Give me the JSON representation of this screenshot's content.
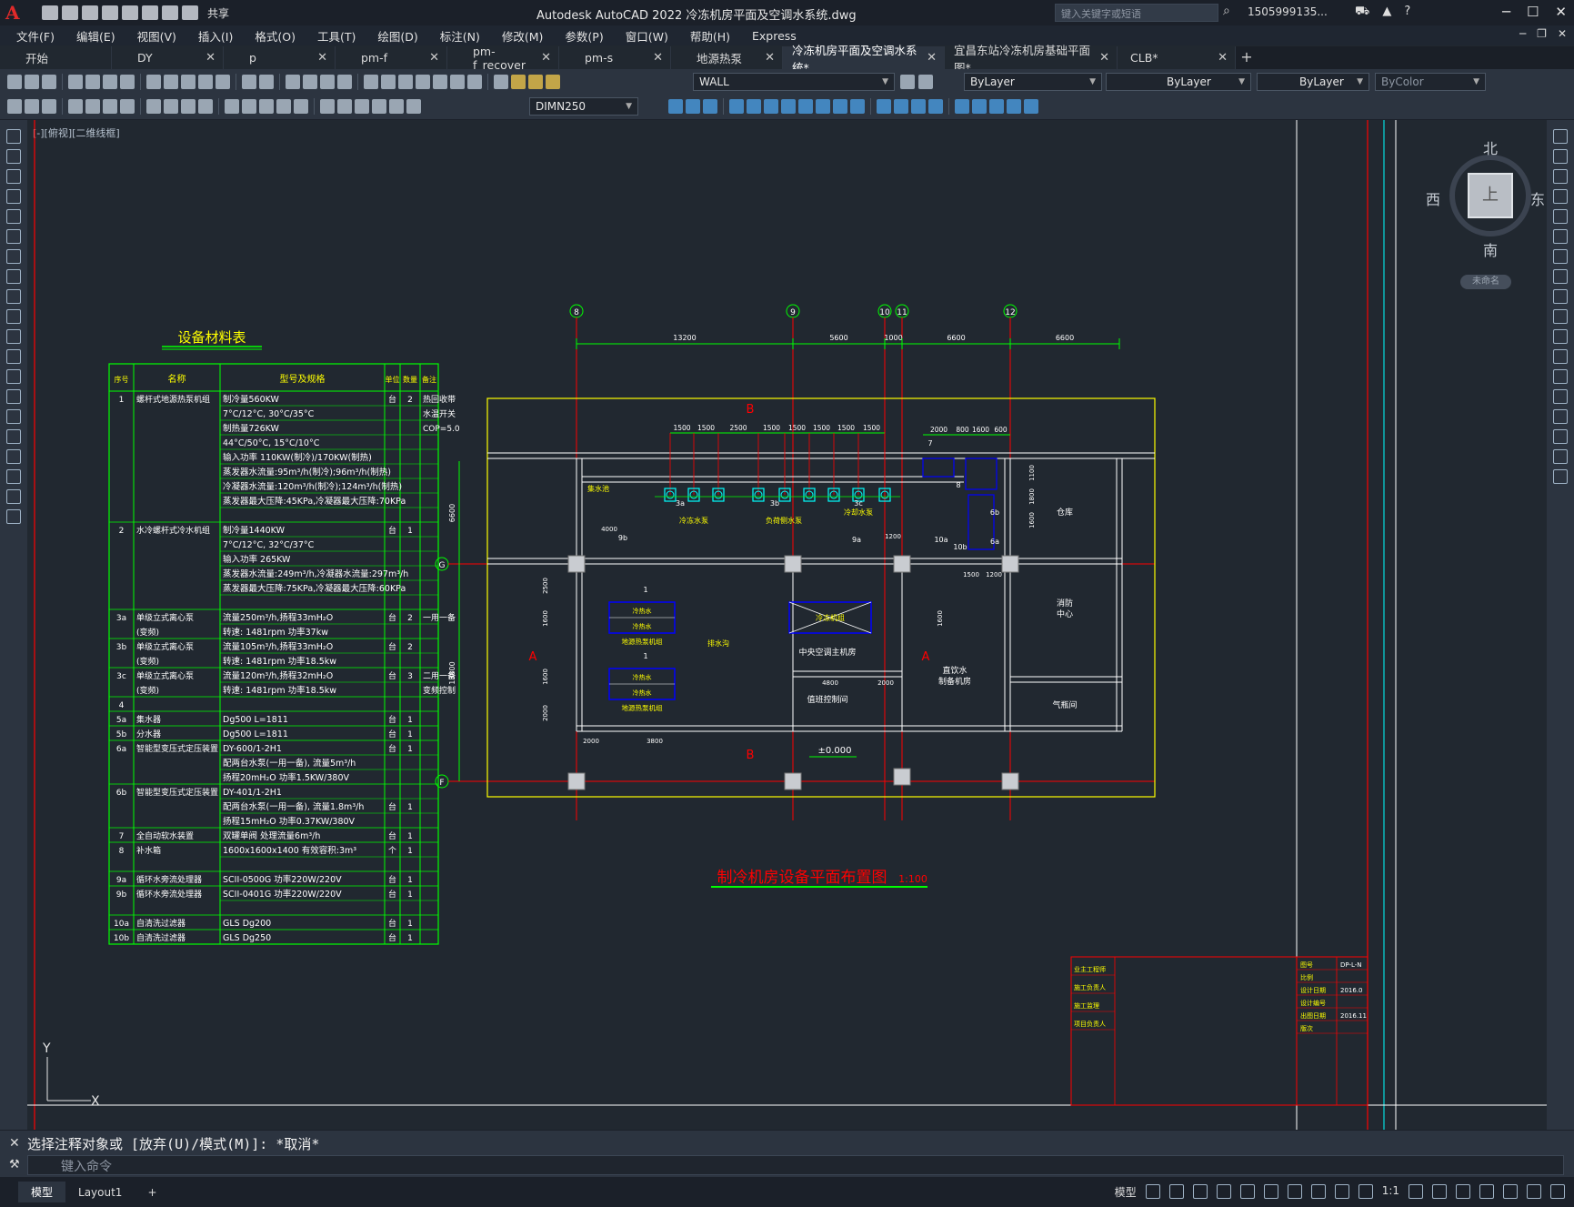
{
  "window": {
    "title": "Autodesk AutoCAD 2022    冷冻机房平面及空调水系统.dwg",
    "share": "共享",
    "search_placeholder": "键入关键字或短语",
    "user": "1505999135...",
    "logo": "A"
  },
  "menu": [
    "文件(F)",
    "编辑(E)",
    "视图(V)",
    "插入(I)",
    "格式(O)",
    "工具(T)",
    "绘图(D)",
    "标注(N)",
    "修改(M)",
    "参数(P)",
    "窗口(W)",
    "帮助(H)",
    "Express"
  ],
  "tabs": [
    {
      "label": "开始"
    },
    {
      "label": "DY"
    },
    {
      "label": "p"
    },
    {
      "label": "pm-f"
    },
    {
      "label": "pm-f_recover"
    },
    {
      "label": "pm-s"
    },
    {
      "label": "地源热泵"
    },
    {
      "label": "冷冻机房平面及空调水系统*",
      "active": true
    },
    {
      "label": "宜昌东站冷冻机房基础平面图*"
    },
    {
      "label": "CLB*"
    }
  ],
  "ribbon": {
    "layer": "WALL",
    "color": "ByLayer",
    "linetype": "ByLayer",
    "lineweight": "ByLayer",
    "plotstyle": "ByColor",
    "dimstyle": "DIMN250"
  },
  "viewport": {
    "label": "[-][俯视][二维线框]"
  },
  "navcube": {
    "north": "北",
    "south": "南",
    "east": "东",
    "west": "西",
    "face": "上",
    "unnamed": "未命名"
  },
  "drawing": {
    "table_title": "设备材料表",
    "table_header": [
      "序号",
      "名称",
      "型号及规格",
      "单位",
      "数量",
      "备注"
    ],
    "table_rows": [
      [
        "1",
        "螺杆式地源热泵机组",
        "制冷量560KW",
        "台",
        "2",
        "热回收带"
      ],
      [
        "",
        "",
        "7°C/12°C, 30°C/35°C",
        "",
        "",
        "水温开关"
      ],
      [
        "",
        "",
        "制热量726KW",
        "",
        "",
        "COP=5.0"
      ],
      [
        "",
        "",
        "44°C/50°C, 15°C/10°C",
        "",
        "",
        ""
      ],
      [
        "",
        "",
        "输入功率 110KW(制冷)/170KW(制热)",
        "",
        "",
        ""
      ],
      [
        "",
        "",
        "蒸发器水流量:95m³/h(制冷);96m³/h(制热)",
        "",
        "",
        ""
      ],
      [
        "",
        "",
        "冷凝器水流量:120m³/h(制冷);124m³/h(制热)",
        "",
        "",
        ""
      ],
      [
        "",
        "",
        "蒸发器最大压降:45KPa,冷凝器最大压降:70KPa",
        "",
        "",
        ""
      ],
      [
        "",
        "",
        "",
        "",
        "",
        ""
      ],
      [
        "2",
        "水冷螺杆式冷水机组",
        "制冷量1440KW",
        "台",
        "1",
        ""
      ],
      [
        "",
        "",
        "7°C/12°C, 32°C/37°C",
        "",
        "",
        ""
      ],
      [
        "",
        "",
        "输入功率 265KW",
        "",
        "",
        ""
      ],
      [
        "",
        "",
        "蒸发器水流量:249m³/h,冷凝器水流量:297m³/h",
        "",
        "",
        ""
      ],
      [
        "",
        "",
        "蒸发器最大压降:75KPa,冷凝器最大压降:60KPa",
        "",
        "",
        ""
      ],
      [
        "",
        "",
        "",
        "",
        "",
        ""
      ],
      [
        "3a",
        "单级立式离心泵",
        "流量250m³/h,扬程33mH₂O",
        "台",
        "2",
        "一用一备"
      ],
      [
        "",
        "(变频)",
        "转速: 1481rpm  功率37kw",
        "",
        "",
        ""
      ],
      [
        "3b",
        "单级立式离心泵",
        "流量105m³/h,扬程33mH₂O",
        "台",
        "2",
        ""
      ],
      [
        "",
        "(变频)",
        "转速: 1481rpm  功率18.5kw",
        "",
        "",
        ""
      ],
      [
        "3c",
        "单级立式离心泵",
        "流量120m³/h,扬程32mH₂O",
        "台",
        "3",
        "二用一备"
      ],
      [
        "",
        "(变频)",
        "转速: 1481rpm  功率18.5kw",
        "",
        "",
        "变频控制"
      ],
      [
        "4",
        "",
        "",
        "",
        "",
        ""
      ],
      [
        "5a",
        "集水器",
        "Dg500  L=1811",
        "台",
        "1",
        ""
      ],
      [
        "5b",
        "分水器",
        "Dg500  L=1811",
        "台",
        "1",
        ""
      ],
      [
        "6a",
        "智能型变压式定压装置",
        "DY-600/1-2H1",
        "台",
        "1",
        ""
      ],
      [
        "",
        "",
        "配两台水泵(一用一备),  流量5m³/h",
        "",
        "",
        ""
      ],
      [
        "",
        "",
        "扬程20mH₂O 功率1.5KW/380V",
        "",
        "",
        ""
      ],
      [
        "6b",
        "智能型变压式定压装置",
        "DY-401/1-2H1",
        "",
        "",
        ""
      ],
      [
        "",
        "",
        "配两台水泵(一用一备),  流量1.8m³/h",
        "台",
        "1",
        ""
      ],
      [
        "",
        "",
        "扬程15mH₂O 功率0.37KW/380V",
        "",
        "",
        ""
      ],
      [
        "7",
        "全自动软水装置",
        "双罐单阀   处理流量6m³/h",
        "台",
        "1",
        ""
      ],
      [
        "8",
        "补水箱",
        "1600x1600x1400 有效容积:3m³",
        "个",
        "1",
        ""
      ],
      [
        "",
        "",
        "",
        "",
        "",
        ""
      ],
      [
        "9a",
        "循环水旁流处理器",
        "SCII-0500G  功率220W/220V",
        "台",
        "1",
        ""
      ],
      [
        "9b",
        "循环水旁流处理器",
        "SCII-0401G  功率220W/220V",
        "台",
        "1",
        ""
      ],
      [
        "",
        "",
        "",
        "",
        "",
        ""
      ],
      [
        "10a",
        "自清洗过滤器",
        "GLS  Dg200",
        "台",
        "1",
        ""
      ],
      [
        "10b",
        "自清洗过滤器",
        "GLS  Dg250",
        "台",
        "1",
        ""
      ]
    ],
    "plan_title": "制冷机房设备平面布置图",
    "plan_scale": "1:100",
    "axes": [
      "8",
      "9",
      "10",
      "11",
      "12"
    ],
    "axis_rows": [
      "G",
      "F"
    ],
    "dims_top": [
      "13200",
      "5600",
      "1000",
      "6600",
      "6600"
    ],
    "dims_pumps": [
      "1500",
      "1500",
      "2500",
      "1500",
      "1500",
      "1500",
      "1500",
      "1500"
    ],
    "dims_right": [
      "2000",
      "800",
      "1600",
      "600"
    ],
    "dims_left": [
      "6600",
      "13800"
    ],
    "dims_misc": [
      "4000",
      "2000",
      "3800",
      "4800",
      "2000",
      "1500",
      "1200",
      "1200",
      "2500",
      "1600",
      "1600",
      "2000",
      "1600",
      "1100",
      "1800",
      "1600"
    ],
    "rooms": [
      "仓库",
      "消防中心",
      "气瓶间",
      "中央空调主机房",
      "值班控制间",
      "直饮水制备机房",
      "冷冻机组"
    ],
    "labels": [
      "集水池",
      "冷冻水泵",
      "冷却水泵",
      "负荷侧水泵",
      "地源热泵机组",
      "地源热泵机组",
      "排水沟",
      "冷热水",
      "冷热水"
    ],
    "section_marks": [
      "B",
      "B",
      "A",
      "A"
    ],
    "elevation": "±0.000",
    "numbers": [
      "1",
      "1",
      "3a",
      "3b",
      "3c",
      "7",
      "8",
      "6b",
      "6a",
      "9a",
      "9b",
      "10a",
      "10b"
    ],
    "titleblock_left": [
      "业主工程师",
      "施工负责人",
      "施工监理",
      "项目负责人"
    ],
    "titleblock_right": [
      "图号",
      "比例",
      "设计日期",
      "设计编号",
      "出图日期",
      "版次"
    ],
    "titleblock_values": [
      "DP-L-N",
      "",
      "2016.0",
      "",
      "2016.11",
      ""
    ]
  },
  "ucs": {
    "y": "Y",
    "x": "X"
  },
  "command": {
    "history": "选择注释对象或 [放弃(U)/模式(M)]: *取消*",
    "placeholder": "键入命令"
  },
  "status": {
    "tabs": [
      "模型",
      "Layout1"
    ],
    "model": "模型",
    "scale": "1:1"
  },
  "colors": {
    "green": "#00ff00",
    "red": "#ff0000",
    "yellow": "#ffff00",
    "cyan": "#00ffff",
    "white": "#ffffff",
    "magenta": "#ff00ff",
    "blue": "#0000ff",
    "bg": "#212830"
  }
}
